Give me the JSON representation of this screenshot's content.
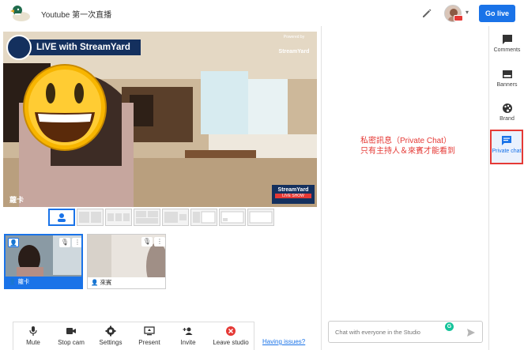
{
  "header": {
    "title": "Youtube 第一次直播",
    "go_live_label": "Go live"
  },
  "stage": {
    "banner_text": "LIVE with StreamYard",
    "powered_by": "Powered by",
    "powered_brand": "StreamYard",
    "participant_name": "蘿卡",
    "badge_title": "StreamYard",
    "badge_subtitle": "LIVE SHOW"
  },
  "guests": [
    {
      "name": "蘿卡",
      "on_stage": true
    },
    {
      "name": "來賓",
      "on_stage": false
    }
  ],
  "controls": [
    {
      "label": "Mute",
      "icon": "mic-icon"
    },
    {
      "label": "Stop cam",
      "icon": "camera-icon"
    },
    {
      "label": "Settings",
      "icon": "gear-icon"
    },
    {
      "label": "Present",
      "icon": "present-icon"
    },
    {
      "label": "Invite",
      "icon": "add-person-icon"
    },
    {
      "label": "Leave studio",
      "icon": "close-circle-icon"
    }
  ],
  "having_issues": "Having issues?",
  "chat": {
    "placeholder": "Chat with everyone in the Studio"
  },
  "annotation": {
    "line1": "私密訊息（Private Chat）",
    "line2": "只有主持人＆來賓才能看到"
  },
  "rail": [
    {
      "label": "Comments",
      "icon": "comment-icon"
    },
    {
      "label": "Banners",
      "icon": "banner-icon"
    },
    {
      "label": "Brand",
      "icon": "palette-icon"
    },
    {
      "label": "Private chat",
      "icon": "private-chat-icon",
      "active": true
    }
  ],
  "colors": {
    "accent": "#1a73e8",
    "annotation": "#e53935",
    "banner": "#14305e",
    "leave": "#e53935"
  }
}
